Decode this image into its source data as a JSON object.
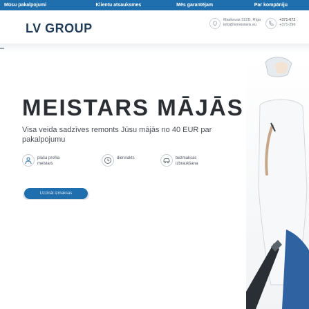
{
  "topnav": {
    "items": [
      "Mūsu pakalpojumi",
      "Klientu atsauksmes",
      "Mēs garantējam",
      "Par kompāniju"
    ]
  },
  "header": {
    "logo": "LV GROUP",
    "address_line1": "Maskavas 322D, Rīga",
    "address_line2": "info@lvmeistaris.eu",
    "phone_line1": "+371-672",
    "phone_line2": "+371-296"
  },
  "hero": {
    "title": "MEISTARS MĀJĀS",
    "subtitle": "Visa veida sadzīves remonts Jūsu mājās no 40 EUR par pakalpojumu",
    "cta": "Uzzināt izmaksas"
  },
  "features": [
    {
      "line1": "plaša profila",
      "line2": "meistars",
      "icon": "worker-icon"
    },
    {
      "line1": "diennakts",
      "line2": "",
      "icon": "clock-icon"
    },
    {
      "line1": "bezmaksas",
      "line2": "izbraukšana",
      "icon": "car-icon"
    }
  ],
  "colors": {
    "accent": "#1f6fae",
    "title": "#2b2f33",
    "logo": "#1f3b57"
  }
}
